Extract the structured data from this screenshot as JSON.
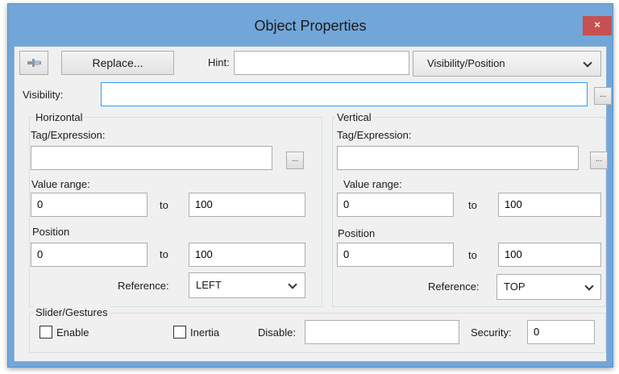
{
  "window": {
    "title": "Object Properties",
    "close_glyph": "×"
  },
  "toolbar": {
    "pin_icon": "pin-icon",
    "replace_label": "Replace...",
    "hint_label": "Hint:",
    "hint_value": "",
    "category_selected": "Visibility/Position"
  },
  "visibility": {
    "label": "Visibility:",
    "value": "",
    "browse_label": "..."
  },
  "horizontal": {
    "legend": "Horizontal",
    "tag_label": "Tag/Expression:",
    "tag_value": "",
    "browse_label": "...",
    "value_range_label": "Value range:",
    "range_from": "0",
    "range_to_label": "to",
    "range_to": "100",
    "position_label": "Position",
    "position_from": "0",
    "position_to_label": "to",
    "position_to": "100",
    "reference_label": "Reference:",
    "reference_selected": "LEFT"
  },
  "vertical": {
    "legend": "Vertical",
    "tag_label": "Tag/Expression:",
    "tag_value": "",
    "browse_label": "...",
    "value_range_label": "Value range:",
    "range_from": "0",
    "range_to_label": "to",
    "range_to": "100",
    "position_label": "Position",
    "position_from": "0",
    "position_to_label": "to",
    "position_to": "100",
    "reference_label": "Reference:",
    "reference_selected": "TOP"
  },
  "slider": {
    "legend": "Slider/Gestures",
    "enable_label": "Enable",
    "enable_checked": false,
    "inertia_label": "Inertia",
    "inertia_checked": false,
    "disable_label": "Disable:",
    "disable_value": "",
    "security_label": "Security:",
    "security_value": "0"
  },
  "colors": {
    "frame": "#72a6d8",
    "client": "#f0f0f0",
    "close": "#c75050",
    "focus_border": "#3399ff"
  }
}
